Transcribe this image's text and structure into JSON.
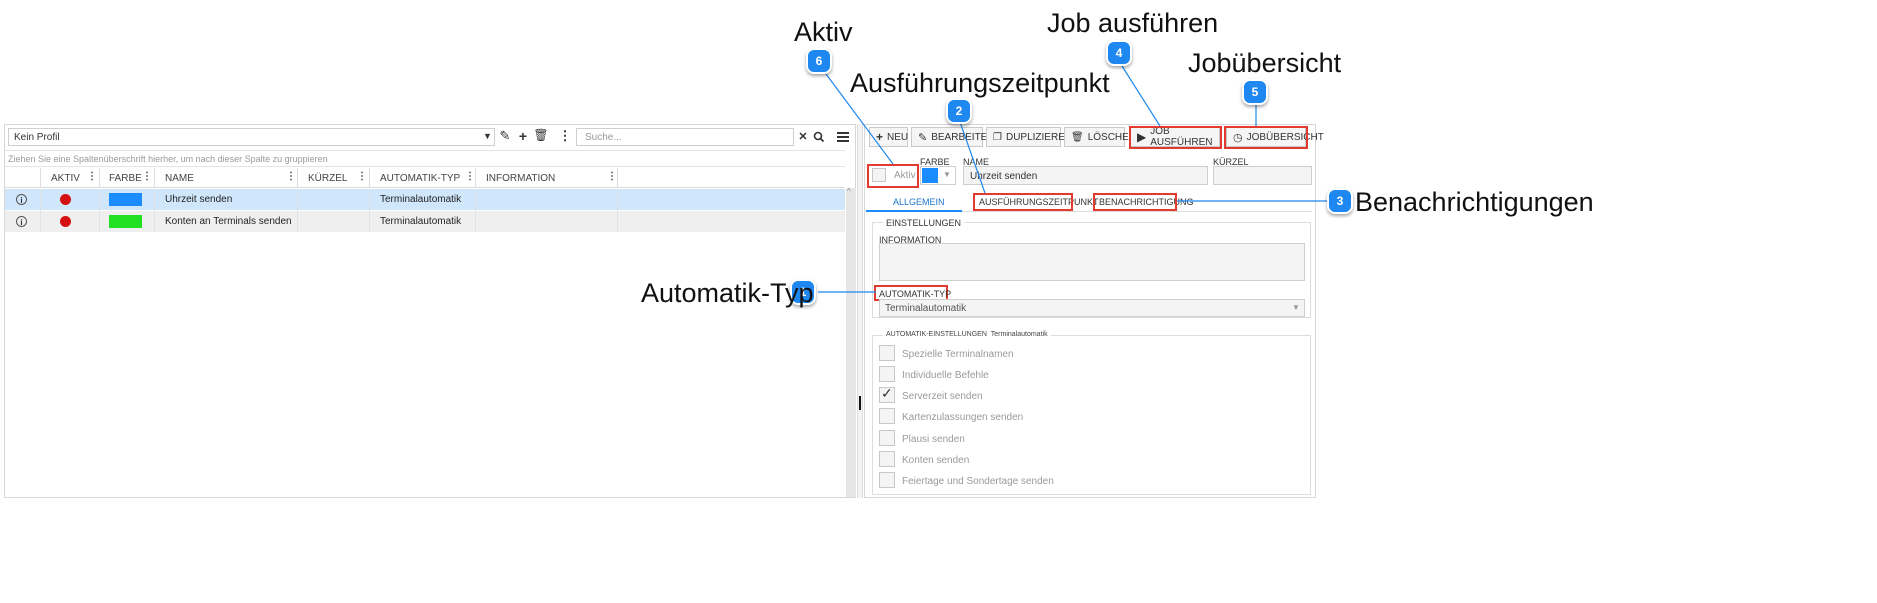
{
  "callouts": [
    {
      "num": "1",
      "label": "Automatik-Typ"
    },
    {
      "num": "2",
      "label": "Ausführungszeitpunkt"
    },
    {
      "num": "3",
      "label": "Benachrichtigungen"
    },
    {
      "num": "4",
      "label": "Job ausführen"
    },
    {
      "num": "5",
      "label": "Jobübersicht"
    },
    {
      "num": "6",
      "label": "Aktiv"
    }
  ],
  "left": {
    "profile_select": "Kein Profil",
    "search_placeholder": "Suche...",
    "group_hint": "Ziehen Sie eine Spaltenüberschrift hierher, um nach dieser Spalte zu gruppieren",
    "columns": [
      "AKTIV",
      "FARBE",
      "NAME",
      "KÜRZEL",
      "AUTOMATIK-TYP",
      "INFORMATION"
    ],
    "rows": [
      {
        "name": "Uhrzeit senden",
        "kuerzel": "",
        "typ": "Terminalautomatik",
        "info": "",
        "color": "#1a8cff",
        "active_color": "#d41010",
        "selected": true
      },
      {
        "name": "Konten an Terminals senden",
        "kuerzel": "",
        "typ": "Terminalautomatik",
        "info": "",
        "color": "#22e022",
        "active_color": "#d41010",
        "selected": false
      }
    ]
  },
  "toolbar": {
    "new": "NEU",
    "edit": "BEARBEITEN",
    "duplicate": "DUPLIZIEREN",
    "delete": "LÖSCHEN",
    "run": "JOB AUSFÜHREN",
    "overview": "JOBÜBERSICHT"
  },
  "detail": {
    "aktiv_label": "Aktiv",
    "farbe_label": "FARBE",
    "name_label": "NAME",
    "name_value": "Uhrzeit senden",
    "kuerzel_label": "KÜRZEL",
    "kuerzel_value": "",
    "farbe_value": "#1a8cff",
    "tabs": [
      "ALLGEMEIN",
      "AUSFÜHRUNGSZEITPUNKT",
      "BENACHRICHTIGUNG"
    ],
    "einstellungen_label": "EINSTELLUNGEN",
    "information_label": "INFORMATION",
    "information_value": "",
    "typ_label": "AUTOMATIK-TYP",
    "typ_value": "Terminalautomatik",
    "auto_settings_label": "AUTOMATIK-EINSTELLUNGEN",
    "auto_settings_sub": "Terminalautomatik",
    "options": [
      {
        "label": "Spezielle Terminalnamen",
        "checked": false
      },
      {
        "label": "Individuelle Befehle",
        "checked": false
      },
      {
        "label": "Serverzeit senden",
        "checked": true
      },
      {
        "label": "Kartenzulassungen senden",
        "checked": false
      },
      {
        "label": "Plausi senden",
        "checked": false
      },
      {
        "label": "Konten senden",
        "checked": false
      },
      {
        "label": "Feiertage und Sondertage senden",
        "checked": false
      }
    ]
  },
  "colors": {
    "callout": "#1e88f0",
    "highlight": "#e23a2e",
    "selected_row": "#cfe6fb"
  }
}
